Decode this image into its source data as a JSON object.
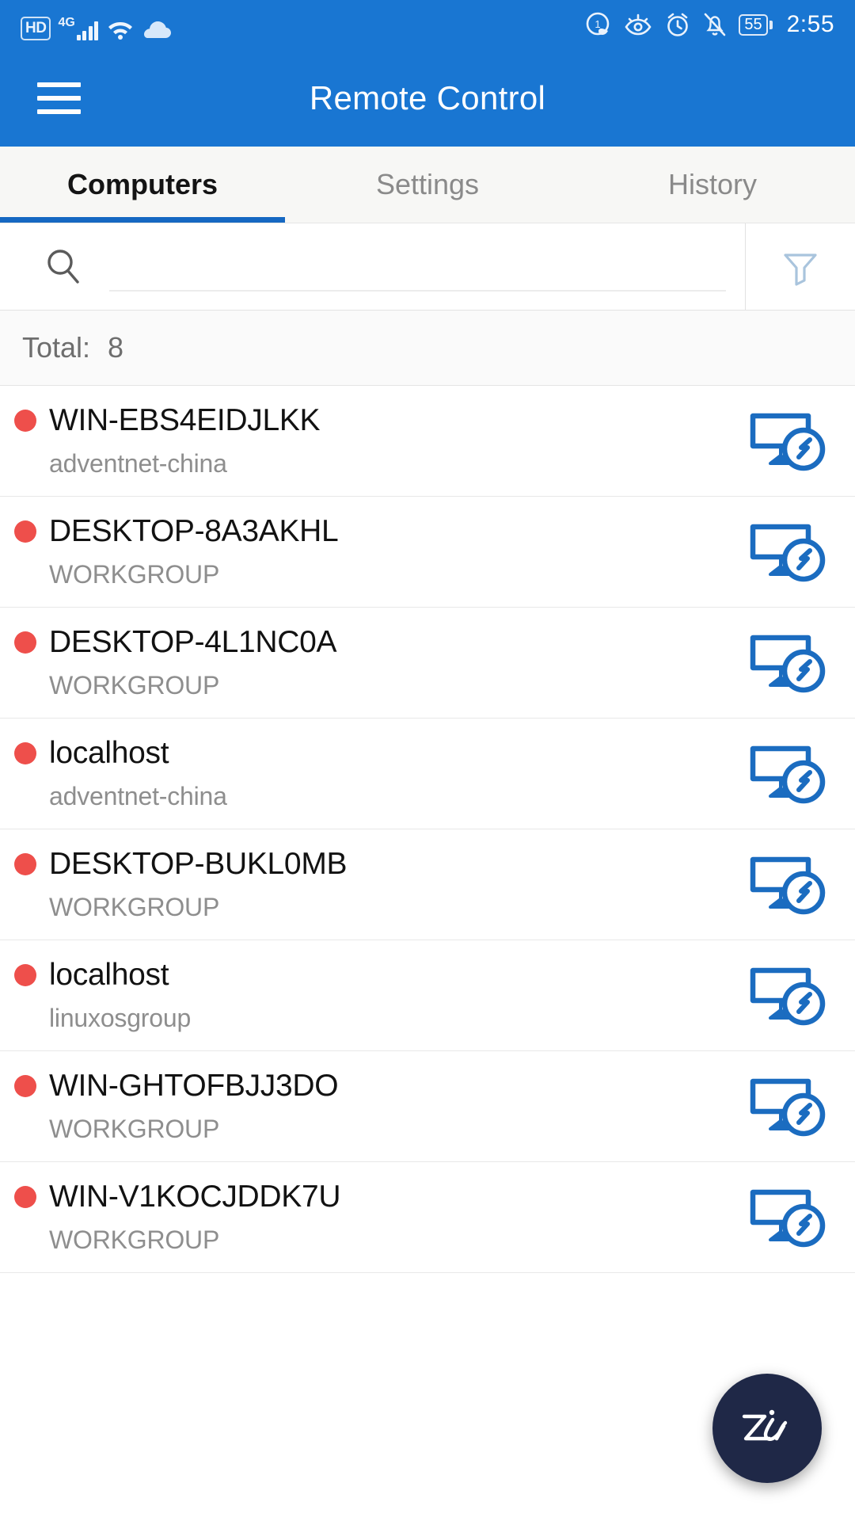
{
  "status_bar": {
    "hd_badge": "HD",
    "network": "4G",
    "signal_icon": "signal-bars-icon",
    "wifi_icon": "wifi-icon",
    "cloud_icon": "cloud-icon",
    "data_saver_icon": "data-saver-icon",
    "eye_comfort_icon": "eye-comfort-icon",
    "alarm_icon": "alarm-clock-icon",
    "silent_icon": "bell-muted-icon",
    "battery_level": "55",
    "time": "2:55"
  },
  "app_bar": {
    "menu_icon": "hamburger-menu-icon",
    "title": "Remote Control"
  },
  "tabs": [
    {
      "label": "Computers",
      "active": true
    },
    {
      "label": "Settings",
      "active": false
    },
    {
      "label": "History",
      "active": false
    }
  ],
  "search": {
    "icon": "search-icon",
    "value": "",
    "placeholder": "",
    "filter_icon": "filter-funnel-icon"
  },
  "total": {
    "label": "Total:",
    "value": "8"
  },
  "colors": {
    "header_blue": "#1976d2",
    "tab_indicator": "#1668c2",
    "status_dot_offline": "#ee4f4b",
    "action_icon_blue": "#1b6cc0",
    "filter_icon": "#a9c4dd",
    "fab_background": "#1f2847"
  },
  "computers": [
    {
      "name": "WIN-EBS4EIDJLKK",
      "group": "adventnet-china",
      "status": "offline",
      "action_icon": "remote-desktop-icon"
    },
    {
      "name": "DESKTOP-8A3AKHL",
      "group": "WORKGROUP",
      "status": "offline",
      "action_icon": "remote-desktop-icon"
    },
    {
      "name": "DESKTOP-4L1NC0A",
      "group": "WORKGROUP",
      "status": "offline",
      "action_icon": "remote-desktop-icon"
    },
    {
      "name": "localhost",
      "group": "adventnet-china",
      "status": "offline",
      "action_icon": "remote-desktop-icon"
    },
    {
      "name": "DESKTOP-BUKL0MB",
      "group": "WORKGROUP",
      "status": "offline",
      "action_icon": "remote-desktop-icon"
    },
    {
      "name": "localhost",
      "group": "linuxosgroup",
      "status": "offline",
      "action_icon": "remote-desktop-icon"
    },
    {
      "name": "WIN-GHTOFBJJ3DO",
      "group": "WORKGROUP",
      "status": "offline",
      "action_icon": "remote-desktop-icon"
    },
    {
      "name": "WIN-V1KOCJDDK7U",
      "group": "WORKGROUP",
      "status": "offline",
      "action_icon": "remote-desktop-icon"
    }
  ],
  "fab": {
    "icon": "zia-assistant-icon",
    "label": "Zia"
  }
}
